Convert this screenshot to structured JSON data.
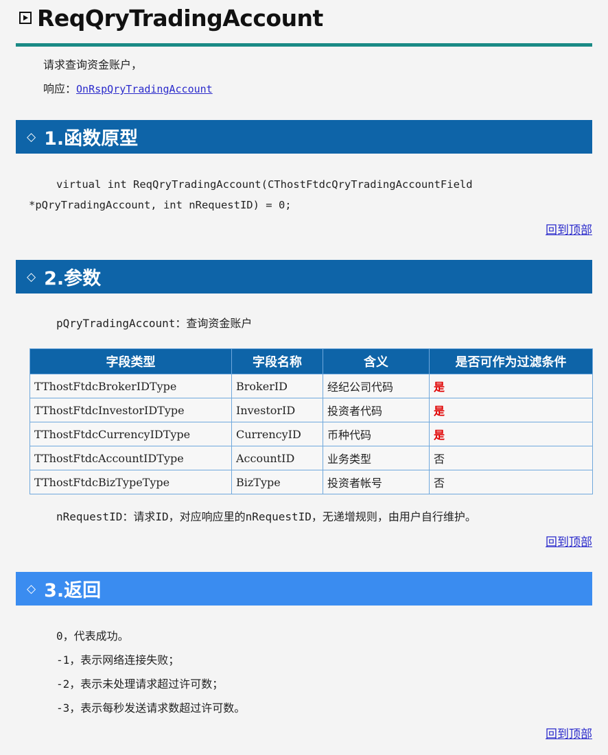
{
  "title": "ReqQryTradingAccount",
  "intro": {
    "description": "请求查询资金账户，",
    "response_label": "响应：",
    "response_link": "OnRspQryTradingAccount"
  },
  "sections": [
    {
      "label": "1.函数原型"
    },
    {
      "label": "2.参数"
    },
    {
      "label": "3.返回"
    }
  ],
  "prototype": {
    "line1": "virtual int ReqQryTradingAccount(CThostFtdcQryTradingAccountField",
    "line2": "*pQryTradingAccount, int nRequestID) = 0;"
  },
  "back_to_top": "回到顶部",
  "params": {
    "intro": "pQryTradingAccount：查询资金账户",
    "headers": [
      "字段类型",
      "字段名称",
      "含义",
      "是否可作为过滤条件"
    ],
    "rows": [
      [
        "TThostFtdcBrokerIDType",
        "BrokerID",
        "经纪公司代码",
        "是"
      ],
      [
        "TThostFtdcInvestorIDType",
        "InvestorID",
        "投资者代码",
        "是"
      ],
      [
        "TThostFtdcCurrencyIDType",
        "CurrencyID",
        "币种代码",
        "是"
      ],
      [
        "TThostFtdcAccountIDType",
        "AccountID",
        "业务类型",
        "否"
      ],
      [
        "TThostFtdcBizTypeType",
        "BizType",
        "投资者帐号",
        "否"
      ]
    ],
    "request_id_note": "nRequestID：请求ID，对应响应里的nRequestID，无递增规则，由用户自行维护。"
  },
  "returns": [
    "0，代表成功。",
    "-1，表示网络连接失败；",
    "-2，表示未处理请求超过许可数；",
    "-3，表示每秒发送请求数超过许可数。"
  ],
  "colors": {
    "accent_rule": "#1a8a85",
    "section_bar": "#0e64a8",
    "section_bar_light": "#3a8cf0",
    "filter_yes": "#e00000"
  }
}
